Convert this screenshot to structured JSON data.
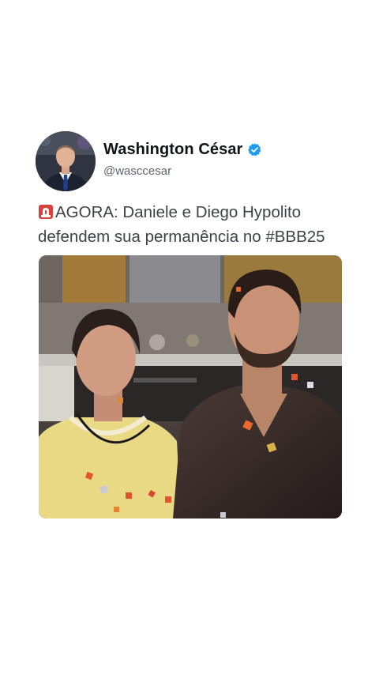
{
  "author": {
    "display_name": "Washington César",
    "handle": "@wasccesar",
    "verified": true,
    "verified_color": "#1d9bf0"
  },
  "tweet": {
    "emoji_icon": "siren-icon",
    "text_line1": "AGORA: Daniele e Diego Hypolito",
    "text_line2": "defendem sua permanência no #BBB25"
  },
  "colors": {
    "text": "#3d4248",
    "name": "#0f1419",
    "handle": "#5b6670"
  }
}
